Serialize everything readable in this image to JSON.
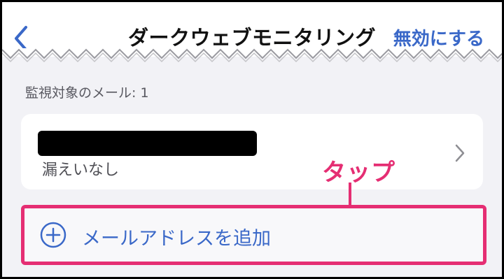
{
  "header": {
    "title": "ダークウェブモニタリング",
    "action_label": "無効にする",
    "back_icon": "chevron-left-icon"
  },
  "monitored": {
    "label": "監視対象のメール: 1"
  },
  "email_item": {
    "status": "漏えいなし",
    "chevron_icon": "chevron-right-icon"
  },
  "add_email": {
    "label": "メールアドレスを追加",
    "icon": "plus-circle-icon"
  },
  "annotation": {
    "text": "タップ"
  },
  "colors": {
    "accent_blue": "#3a68c8",
    "annotation_pink": "#e52e73",
    "background": "#f2f2f6"
  }
}
